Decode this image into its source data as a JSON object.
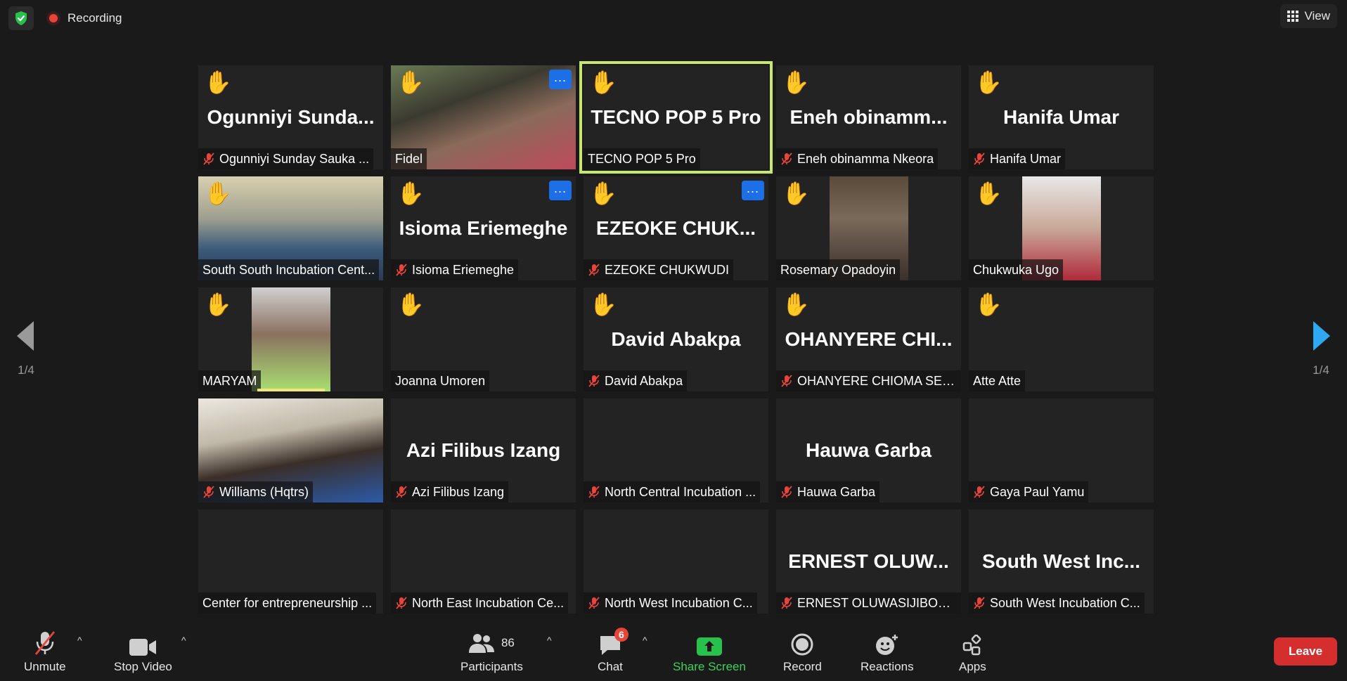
{
  "meeting": {
    "recording_label": "Recording",
    "view_label": "View",
    "page_indicator": "1/4"
  },
  "tiles": [
    {
      "name": "Ogunniyi Sunday Sauka ...",
      "big": "Ogunniyi  Sunda...",
      "hand": true,
      "muted": true,
      "video": null
    },
    {
      "name": "Fidel",
      "big": "",
      "hand": true,
      "muted": false,
      "video": "full",
      "more": true
    },
    {
      "name": "TECNO POP 5 Pro",
      "big": "TECNO POP 5 Pro",
      "hand": true,
      "muted": false,
      "video": null,
      "active": true
    },
    {
      "name": "Eneh obinamma Nkeora",
      "big": "Eneh  obinamm...",
      "hand": true,
      "muted": true,
      "video": null
    },
    {
      "name": "Hanifa Umar",
      "big": "Hanifa Umar",
      "hand": true,
      "muted": true,
      "video": null
    },
    {
      "name": "South South Incubation Cent...",
      "big": "",
      "hand": true,
      "muted": false,
      "video": "full"
    },
    {
      "name": "Isioma Eriemeghe",
      "big": "Isioma Eriemeghe",
      "hand": true,
      "muted": true,
      "video": null,
      "more": true
    },
    {
      "name": "EZEOKE CHUKWUDI",
      "big": "EZEOKE  CHUK...",
      "hand": true,
      "muted": true,
      "video": null,
      "more": true
    },
    {
      "name": "Rosemary Opadoyin",
      "big": "",
      "hand": true,
      "muted": false,
      "video": "narrow"
    },
    {
      "name": "Chukwuka Ugo",
      "big": "",
      "hand": true,
      "muted": false,
      "video": "narrow"
    },
    {
      "name": "MARYAM",
      "big": "",
      "hand": true,
      "muted": false,
      "video": "narrow",
      "speaking": true
    },
    {
      "name": "Joanna Umoren",
      "big": "",
      "hand": true,
      "muted": false,
      "video": null
    },
    {
      "name": "David Abakpa",
      "big": "David Abakpa",
      "hand": true,
      "muted": true,
      "video": null
    },
    {
      "name": "OHANYERE CHIOMA SER...",
      "big": "OHANYERE  CHI...",
      "hand": true,
      "muted": true,
      "video": null
    },
    {
      "name": "Atte Atte",
      "big": "",
      "hand": true,
      "muted": false,
      "video": null
    },
    {
      "name": "Williams (Hqtrs)",
      "big": "",
      "hand": false,
      "muted": true,
      "video": "full"
    },
    {
      "name": "Azi Filibus Izang",
      "big": "Azi Filibus Izang",
      "hand": false,
      "muted": true,
      "video": null
    },
    {
      "name": "North Central Incubation ...",
      "big": "",
      "hand": false,
      "muted": true,
      "video": null
    },
    {
      "name": "Hauwa Garba",
      "big": "Hauwa Garba",
      "hand": false,
      "muted": true,
      "video": null
    },
    {
      "name": "Gaya Paul Yamu",
      "big": "",
      "hand": false,
      "muted": true,
      "video": null
    },
    {
      "name": "Center for entrepreneurship ...",
      "big": "",
      "hand": false,
      "muted": false,
      "video": null
    },
    {
      "name": "North East Incubation Ce...",
      "big": "",
      "hand": false,
      "muted": true,
      "video": null
    },
    {
      "name": "North West Incubation C...",
      "big": "",
      "hand": false,
      "muted": true,
      "video": null
    },
    {
      "name": "ERNEST OLUWASIJIBOMI ...",
      "big": "ERNEST  OLUW...",
      "hand": false,
      "muted": true,
      "video": null
    },
    {
      "name": "South West Incubation C...",
      "big": "South  West  Inc...",
      "hand": false,
      "muted": true,
      "video": null
    }
  ],
  "toolbar": {
    "unmute_label": "Unmute",
    "stop_video_label": "Stop Video",
    "participants_label": "Participants",
    "participants_count": "86",
    "chat_label": "Chat",
    "chat_badge": "6",
    "share_label": "Share Screen",
    "record_label": "Record",
    "reactions_label": "Reactions",
    "apps_label": "Apps",
    "leave_label": "Leave"
  },
  "colors": {
    "accent_green": "#3ed35b",
    "active_speaker": "#c7e86a",
    "leave_red": "#d52e2e",
    "more_blue": "#1d6fe8",
    "next_arrow": "#2ea8f0"
  }
}
